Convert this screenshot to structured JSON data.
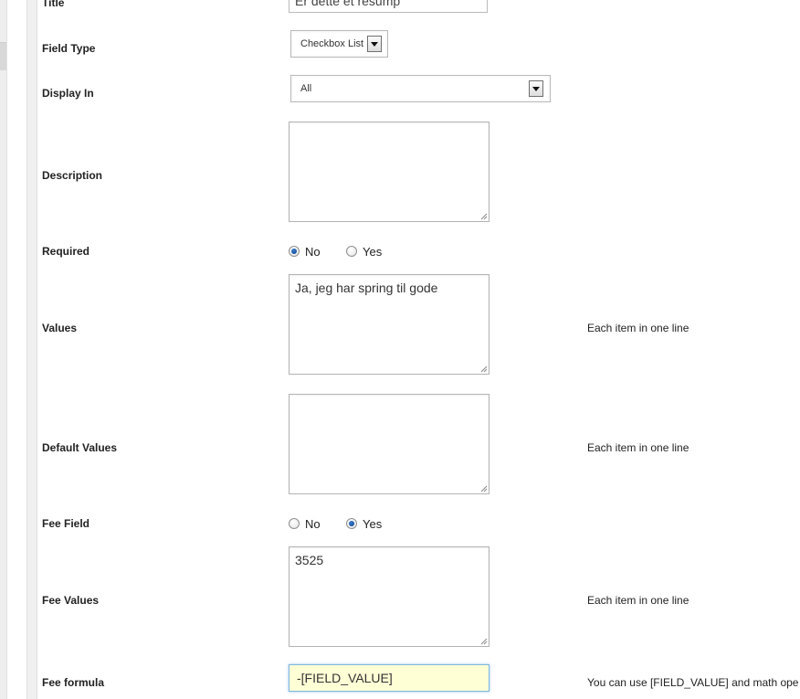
{
  "form": {
    "title": {
      "label": "Title",
      "value": "Er dette et resump"
    },
    "field_type": {
      "label": "Field Type",
      "value": "Checkbox List"
    },
    "display_in": {
      "label": "Display In",
      "value": "All"
    },
    "description": {
      "label": "Description",
      "value": ""
    },
    "required": {
      "label": "Required",
      "options": [
        "No",
        "Yes"
      ],
      "selected": "No"
    },
    "values": {
      "label": "Values",
      "value": "Ja, jeg har spring til gode",
      "note": "Each item in one line"
    },
    "default_values": {
      "label": "Default Values",
      "value": "",
      "note": "Each item in one line"
    },
    "fee_field": {
      "label": "Fee Field",
      "options": [
        "No",
        "Yes"
      ],
      "selected": "Yes"
    },
    "fee_values": {
      "label": "Fee Values",
      "value": "3525",
      "note": "Each item in one line"
    },
    "fee_formula": {
      "label": "Fee formula",
      "value": "-[FIELD_VALUE]",
      "note": "You can use [FIELD_VALUE] and math ope"
    }
  },
  "icons": {
    "select_arrow": "chevron-down-icon",
    "resize_grip": "resize-grip-icon"
  },
  "colors": {
    "radio_checked": "#1a56a8",
    "focused_input_bg": "#ffffd6",
    "focused_input_border": "#7fb6e0"
  }
}
